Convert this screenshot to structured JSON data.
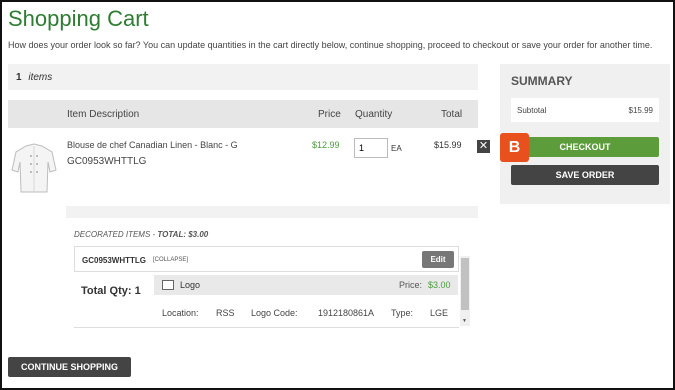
{
  "page": {
    "title": "Shopping Cart",
    "intro": "How does your order look so far? You can update quantities in the cart directly below, continue shopping, proceed to checkout or save your order for another time."
  },
  "cart": {
    "item_count": "1",
    "items_label": "items",
    "headers": {
      "description": "Item Description",
      "price": "Price",
      "quantity": "Quantity",
      "total": "Total"
    },
    "line": {
      "description": "Blouse de chef Canadian Linen - Blanc - G",
      "sku": "GC0953WHTTLG",
      "price": "$12.99",
      "quantity": "1",
      "unit": "EA",
      "total": "$15.99",
      "remove": "✕"
    }
  },
  "decorated": {
    "label": "DECORATED ITEMS - ",
    "total_label": "TOTAL: $3.00",
    "sku": "GC0953WHTTLG",
    "collapse": "[COLLAPSE]",
    "edit": "Edit",
    "total_qty": "Total Qty: 1",
    "logo": {
      "title": "Logo",
      "price_label": "Price:",
      "price": "$3.00",
      "location_label": "Location:",
      "location": "RSS",
      "code_label": "Logo Code:",
      "code": "1912180861A",
      "type_label": "Type:",
      "type": "LGE"
    }
  },
  "summary": {
    "title": "SUMMARY",
    "subtotal_label": "Subtotal",
    "subtotal": "$15.99",
    "checkout": "CHECKOUT",
    "save_order": "SAVE ORDER",
    "badge": "B"
  },
  "actions": {
    "continue_shopping": "CONTINUE SHOPPING"
  },
  "colors": {
    "title_green": "#2e7d32",
    "price_green": "#4a9b3b",
    "checkout_green": "#5d9c3a",
    "dark_button": "#444444",
    "badge_orange": "#e8501e"
  },
  "icons": {
    "remove": "close-icon",
    "logo_image": "image-icon",
    "scroll_down": "chevron-down-icon"
  }
}
